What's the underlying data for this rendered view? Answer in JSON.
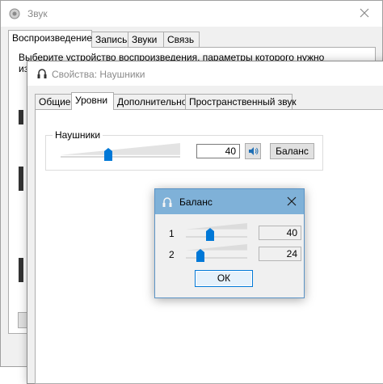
{
  "sound_window": {
    "title": "Звук",
    "tabs": [
      "Воспроизведение",
      "Запись",
      "Звуки",
      "Связь"
    ],
    "active_tab": 0,
    "description_line1": "Выберите устройство воспроизведения, параметры которого нужно",
    "description_line2": "из"
  },
  "props_window": {
    "title": "Свойства: Наушники",
    "tabs": [
      "Общие",
      "Уровни",
      "Дополнительно",
      "Пространственный звук"
    ],
    "active_tab": 1,
    "group_label": "Наушники",
    "volume_value": "40",
    "volume_level": 0.4,
    "speaker_icon": "speaker-icon",
    "balance_button": "Баланс"
  },
  "balance_dialog": {
    "title": "Баланс",
    "channels": [
      {
        "label": "1",
        "value": "40",
        "level": 0.4
      },
      {
        "label": "2",
        "value": "24",
        "level": 0.24
      }
    ],
    "ok_button": "ОК"
  },
  "colors": {
    "accent": "#0078d7",
    "dialog_titlebar": "#7fb1d8",
    "window_bg": "#f0f0f0"
  }
}
